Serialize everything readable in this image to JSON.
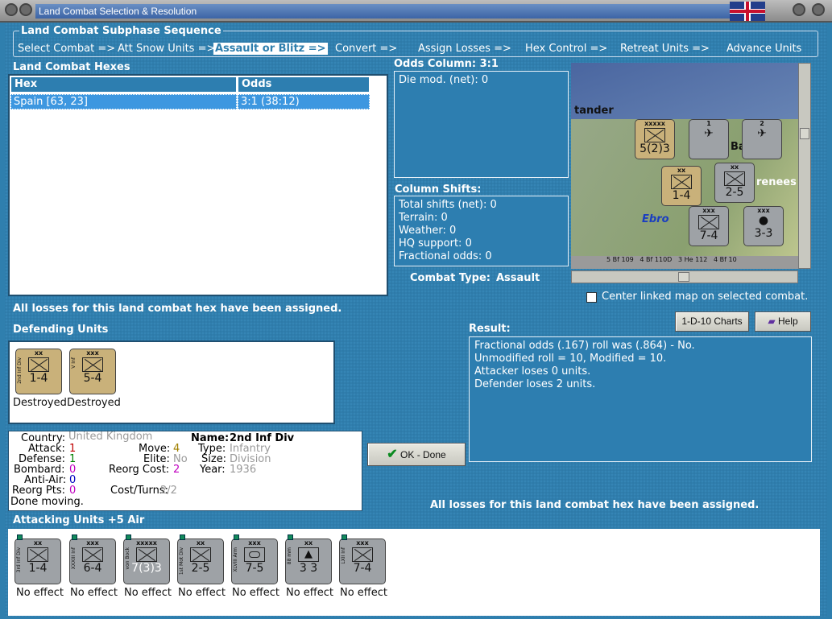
{
  "window": {
    "title": "Land Combat Selection & Resolution"
  },
  "sequence": {
    "title": "Land Combat Subphase Sequence",
    "steps": [
      "Select Combat =>",
      "Att Snow Units =>",
      "Assault or Blitz =>",
      "Convert =>",
      "Assign Losses =>",
      "Hex Control =>",
      "Retreat Units =>",
      "Advance Units"
    ],
    "active_index": 2
  },
  "hexes": {
    "title": "Land Combat Hexes",
    "columns": [
      "Hex",
      "Odds"
    ],
    "rows": [
      {
        "hex": "Spain [63, 23]",
        "odds": "3:1 (38:12)"
      }
    ]
  },
  "odds": {
    "title": "Odds Column: 3:1",
    "die_mod": "Die mod. (net): 0"
  },
  "shifts": {
    "title": "Column Shifts:",
    "lines": [
      "Total shifts (net): 0",
      "Terrain: 0",
      "Weather: 0",
      "HQ support: 0",
      "Fractional odds: 0"
    ]
  },
  "combat_type": {
    "label": "Combat Type:",
    "value": "Assault"
  },
  "map": {
    "labels": [
      "tander",
      "Ebro",
      "renees",
      "Ba"
    ],
    "center_checkbox": "Center linked map on selected combat.",
    "bottom_strip": [
      "5",
      "Bf 109",
      "4",
      "Bf 110D",
      "3",
      "He 112",
      "4",
      "Bf 10"
    ]
  },
  "losses_msg": "All losses for this land combat hex have been assigned.",
  "defending": {
    "title": "Defending Units",
    "units": [
      {
        "size": "xx",
        "side": "2nd Inf Div",
        "str": "1-4",
        "status": "Destroyed",
        "color": "tan"
      },
      {
        "size": "xxx",
        "side": "V Inf",
        "str": "5-4",
        "status": "Destroyed",
        "color": "tan"
      }
    ]
  },
  "unit_info": {
    "country_label": "Country:",
    "country": "United Kingdom",
    "name_label": "Name:",
    "name": "2nd Inf Div",
    "attack_label": "Attack:",
    "attack": "1",
    "defense_label": "Defense:",
    "defense": "1",
    "bombard_label": "Bombard:",
    "bombard": "0",
    "antiair_label": "Anti-Air:",
    "antiair": "0",
    "reorgpts_label": "Reorg Pts:",
    "reorgpts": "0",
    "move_label": "Move:",
    "move": "4",
    "elite_label": "Elite:",
    "elite": "No",
    "reorgcost_label": "Reorg Cost:",
    "reorgcost": "2",
    "costturns_label": "Cost/Turns:",
    "costturns": "2/2",
    "type_label": "Type:",
    "type": "Infantry",
    "size_label": "Size:",
    "size": "Division",
    "year_label": "Year:",
    "year": "1936",
    "status": "Done moving."
  },
  "buttons": {
    "charts": "1-D-10 Charts",
    "help": "Help",
    "ok": "OK - Done"
  },
  "result": {
    "title": "Result:",
    "lines": [
      "Fractional odds (.167) roll was (.864)  - No.",
      "Unmodified roll = 10, Modified = 10.",
      "Attacker loses 0 units.",
      "Defender loses 2 units."
    ]
  },
  "attacking": {
    "title": "Attacking Units +5 Air",
    "units": [
      {
        "size": "xx",
        "side": "3rd Inf Div",
        "str": "1-4",
        "status": "No effect"
      },
      {
        "size": "xxx",
        "side": "XXXIII Inf",
        "str": "6-4",
        "status": "No effect"
      },
      {
        "size": "xxxxx",
        "side": "von Bock",
        "str": "7(3)3",
        "status": "No effect"
      },
      {
        "size": "xx",
        "side": "1st Mot Div",
        "str": "2-5",
        "status": "No effect"
      },
      {
        "size": "xxx",
        "side": "XLVIII Arm",
        "str": "7-5",
        "status": "No effect"
      },
      {
        "size": "xx",
        "side": "88 mm",
        "str": "3 3",
        "status": "No effect"
      },
      {
        "size": "xxx",
        "side": "LXII Inf",
        "str": "7-4",
        "status": "No effect"
      }
    ]
  },
  "colors": {
    "panel": "#2d7eb0",
    "attack": "#c00000",
    "defense": "#008000",
    "bombard": "#c000c0",
    "move": "#a08000"
  }
}
